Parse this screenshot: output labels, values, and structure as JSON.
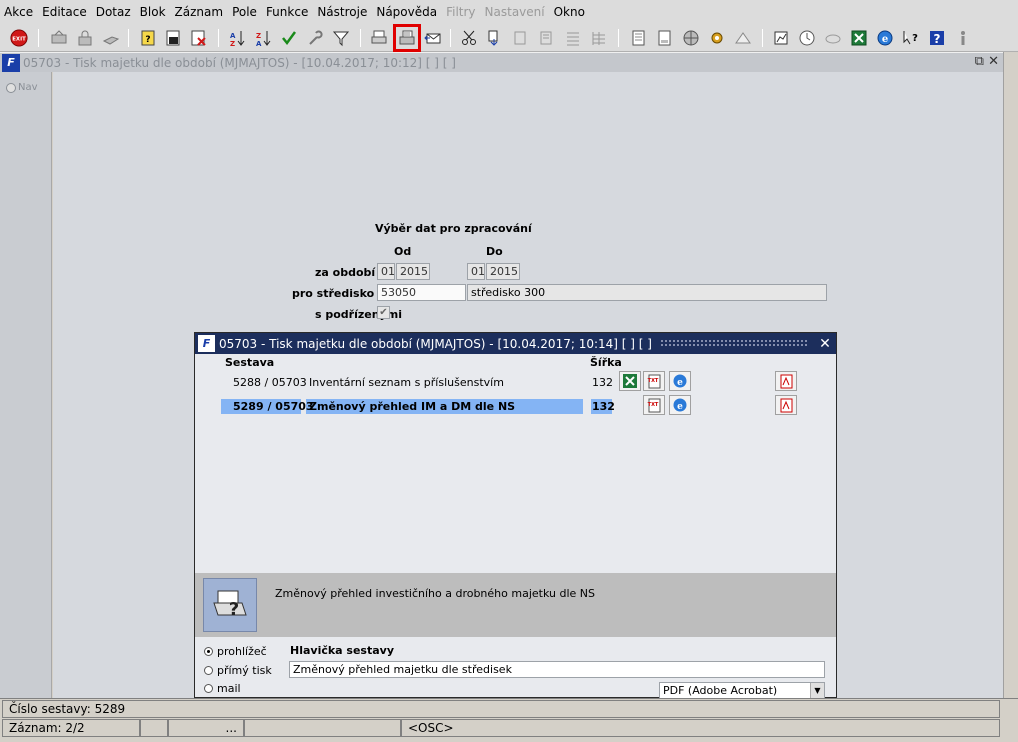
{
  "menu": [
    "Akce",
    "Editace",
    "Dotaz",
    "Blok",
    "Záznam",
    "Pole",
    "Funkce",
    "Nástroje",
    "Nápověda",
    "Filtry",
    "Nastavení",
    "Okno"
  ],
  "menu_disabled": [
    "Filtry",
    "Nastavení"
  ],
  "toolbar": {
    "exit_label": "EXIT"
  },
  "window": {
    "title": "05703 - Tisk majetku dle období (MJMAJTOS) - [10.04.2017; 10:12]  [ ]  [ ]"
  },
  "nav": {
    "label": "Nav"
  },
  "form": {
    "heading": "Výběr dat pro zpracování",
    "col_from": "Od",
    "col_to": "Do",
    "period_label": "za období",
    "from_month": "01",
    "from_year": "2015",
    "to_month": "01",
    "to_year": "2015",
    "center_label": "pro středisko",
    "center_code": "53050",
    "center_name": "středisko 300",
    "sub_label": "s podřízenými"
  },
  "dialog": {
    "title": "05703 - Tisk majetku dle období (MJMAJTOS) - [10.04.2017; 10:14]  [ ]  [ ]",
    "col_report": "Sestava",
    "col_width": "Šířka",
    "rows": [
      {
        "code": "5288 / 05703",
        "name": "Inventární seznam s příslušenstvím",
        "width": "132"
      },
      {
        "code": "5289 / 05703",
        "name": "Změnový přehled IM a DM dle NS",
        "width": "132"
      }
    ],
    "description": "Změnový přehled investičního a drobného majetku dle NS",
    "output_options": [
      "prohlížeč",
      "přímý tisk",
      "mail"
    ],
    "header_label": "Hlavička sestavy",
    "header_value": "Změnový přehled majetku dle středisek",
    "format_value": "PDF (Adobe Acrobat)"
  },
  "status": {
    "line1": "Číslo sestavy: 5289",
    "record": "Záznam: 2/2",
    "field3": "...",
    "field5": "<OSC>"
  },
  "colors": {
    "selection": "#84b4f4",
    "dialog_title": "#1c2e5c",
    "highlight_box": "#e00000"
  }
}
